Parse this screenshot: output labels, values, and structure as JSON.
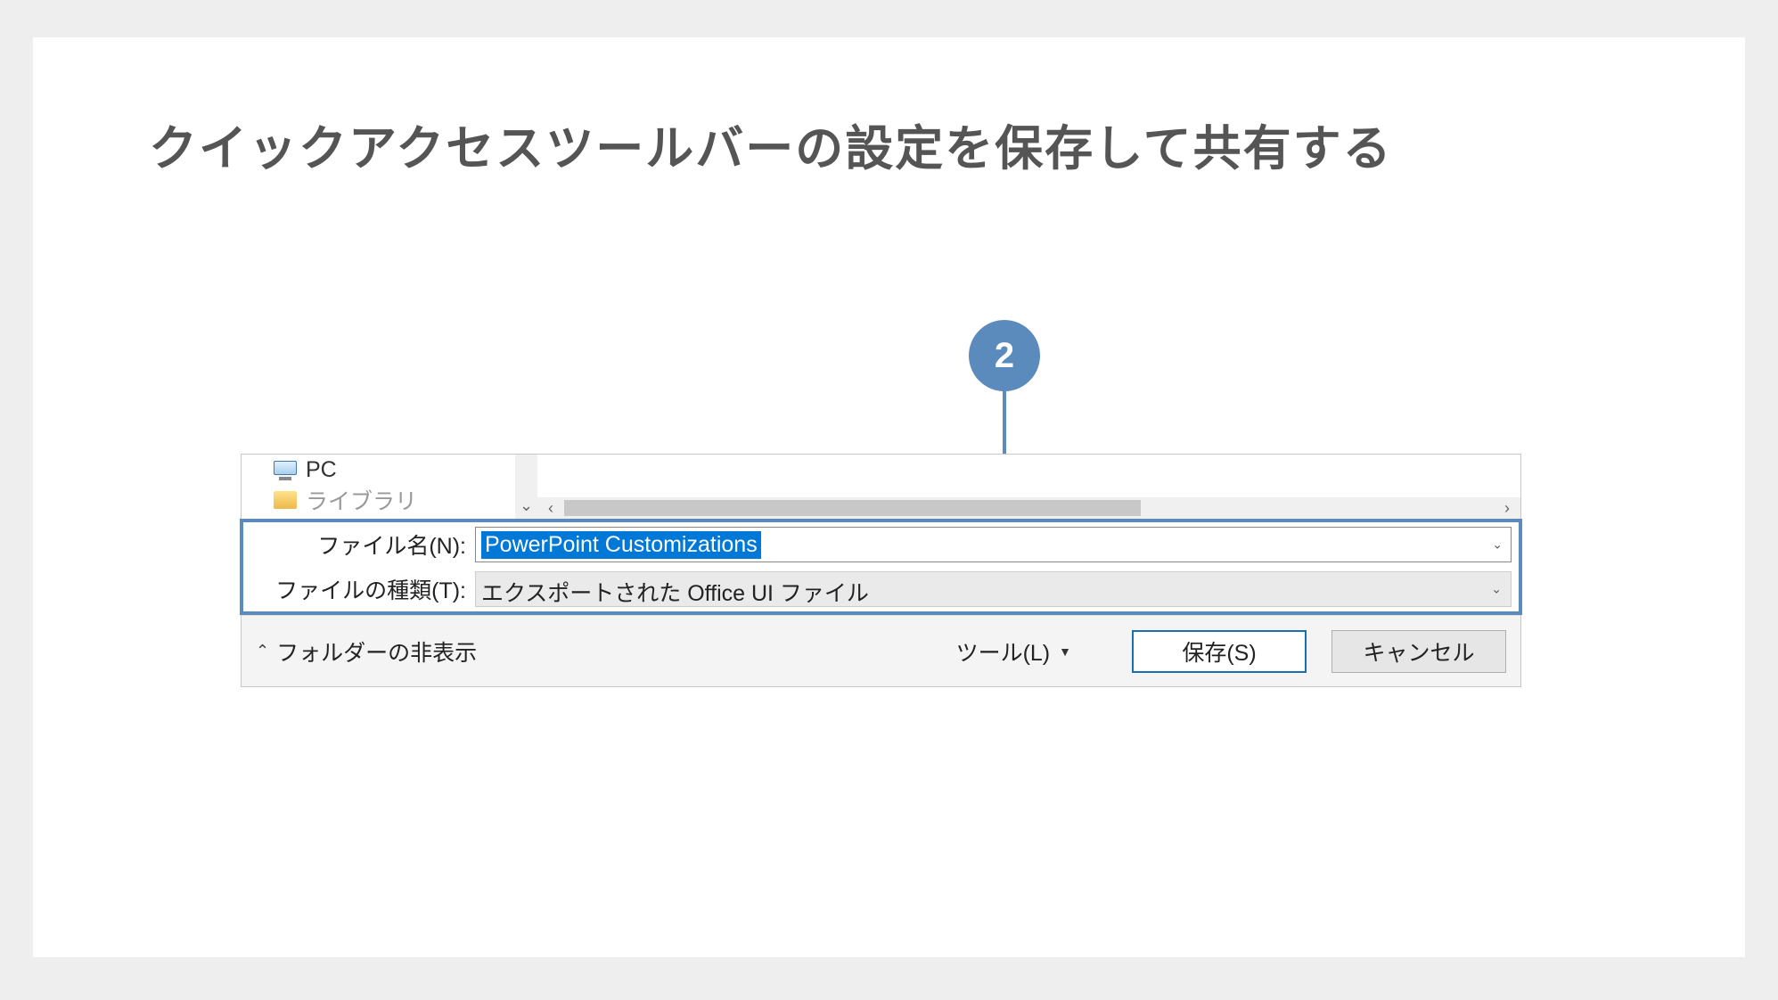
{
  "title": "クイックアクセスツールバーの設定を保存して共有する",
  "callout": {
    "number": "2"
  },
  "dialog": {
    "tree": {
      "items": [
        {
          "label": "PC"
        },
        {
          "label": "ライブラリ"
        }
      ]
    },
    "fileNameLabel": "ファイル名(N):",
    "fileNameValue": "PowerPoint Customizations",
    "fileTypeLabel": "ファイルの種類(T):",
    "fileTypeValue": "エクスポートされた Office UI ファイル",
    "hideFolders": "フォルダーの非表示",
    "tools": "ツール(L)",
    "saveButton": "保存(S)",
    "cancelButton": "キャンセル"
  }
}
